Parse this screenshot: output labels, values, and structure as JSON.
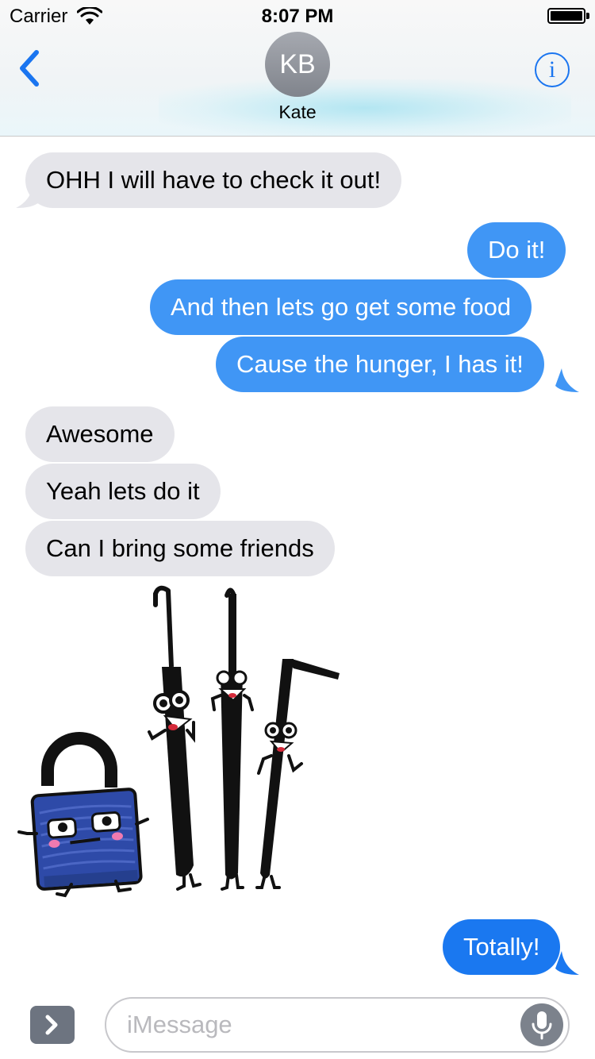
{
  "status_bar": {
    "carrier": "Carrier",
    "time": "8:07 PM"
  },
  "header": {
    "avatar_initials": "KB",
    "contact_name": "Kate",
    "info_label": "i"
  },
  "messages": [
    {
      "direction": "incoming",
      "text": "OHH I will have to check it out!"
    },
    {
      "direction": "outgoing",
      "text": "Do it!"
    },
    {
      "direction": "outgoing",
      "text": "And then lets go get some food"
    },
    {
      "direction": "outgoing",
      "text": "Cause the hunger, I has it!"
    },
    {
      "direction": "incoming",
      "text": "Awesome"
    },
    {
      "direction": "incoming",
      "text": "Yeah lets do it"
    },
    {
      "direction": "incoming",
      "text": "Can I bring some friends"
    },
    {
      "direction": "incoming",
      "sticker": "padlock-and-lockpicks-sticker"
    },
    {
      "direction": "outgoing",
      "text": "Totally!"
    }
  ],
  "input_bar": {
    "placeholder": "iMessage"
  },
  "colors": {
    "outgoing_bubble": "#4096f5",
    "outgoing_bubble_last": "#1a78f0",
    "incoming_bubble": "#e5e5ea",
    "accent": "#1a75f0"
  },
  "icons": [
    "wifi-icon",
    "battery-icon",
    "back-chevron-icon",
    "info-icon",
    "apps-chevron-icon",
    "microphone-icon"
  ]
}
